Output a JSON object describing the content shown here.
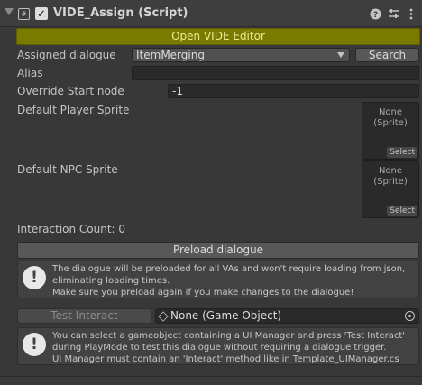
{
  "component": {
    "title": "VIDE_Assign (Script)",
    "fold_icon": "triangle-down-icon",
    "script_icon": "script-icon",
    "enabled": true,
    "help_icon": "help-icon",
    "presets_icon": "presets-icon",
    "menu_icon": "kebab-menu-icon"
  },
  "open_editor_label": "Open VIDE Editor",
  "fields": {
    "assigned_dialogue": {
      "label": "Assigned dialogue",
      "value": "ItemMerging",
      "search_label": "Search"
    },
    "alias": {
      "label": "Alias",
      "value": ""
    },
    "override_start": {
      "label": "Override Start node",
      "value": "-1"
    },
    "player_sprite": {
      "label": "Default Player Sprite",
      "value_line1": "None",
      "value_line2": "(Sprite)",
      "select_label": "Select"
    },
    "npc_sprite": {
      "label": "Default NPC Sprite",
      "value_line1": "None",
      "value_line2": "(Sprite)",
      "select_label": "Select"
    }
  },
  "interaction_count": "Interaction Count: 0",
  "preload": {
    "button_label": "Preload dialogue",
    "help_lines": [
      "The dialogue will be preloaded for all VAs and won't require loading from json,",
      "eliminating loading times.",
      "Make sure you preload again if you make changes to the dialogue!"
    ]
  },
  "test": {
    "button_label": "Test Interact",
    "object_field": "None (Game Object)",
    "help_lines": [
      "You can select a gameobject containing a UI Manager and press 'Test Interact'",
      "during PlayMode to test this dialogue without requiring a dialogue trigger.",
      "UI Manager must contain an 'Interact' method like in Template_UIManager.cs"
    ]
  },
  "colors": {
    "accent_button": "#7a7a00",
    "accent_text": "#ecec90",
    "background": "#383838"
  }
}
